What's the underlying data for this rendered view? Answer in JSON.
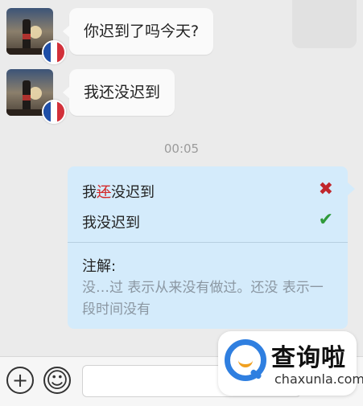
{
  "messages": [
    {
      "text": "你迟到了吗今天?"
    },
    {
      "text": "我还没迟到"
    }
  ],
  "timestamp": "00:05",
  "correction": {
    "option_wrong": {
      "prefix": "我",
      "struck": "还",
      "suffix": "没迟到"
    },
    "option_right": "我没迟到",
    "wrong_mark": "✖",
    "right_mark": "✔",
    "note_title": "注解:",
    "note_body": "没…过 表示从来没有做过。还没 表示一段时间没有"
  },
  "footer": {
    "plus_icon": "+",
    "emoji_icon": "☺"
  },
  "watermark": {
    "cn": "查询啦",
    "en": "chaxunla.com"
  },
  "colors": {
    "background": "#ebebeb",
    "card": "#d4ebfb",
    "wrong": "#c0262c",
    "right": "#2f9a3a",
    "brand_blue": "#2f7fe0"
  }
}
